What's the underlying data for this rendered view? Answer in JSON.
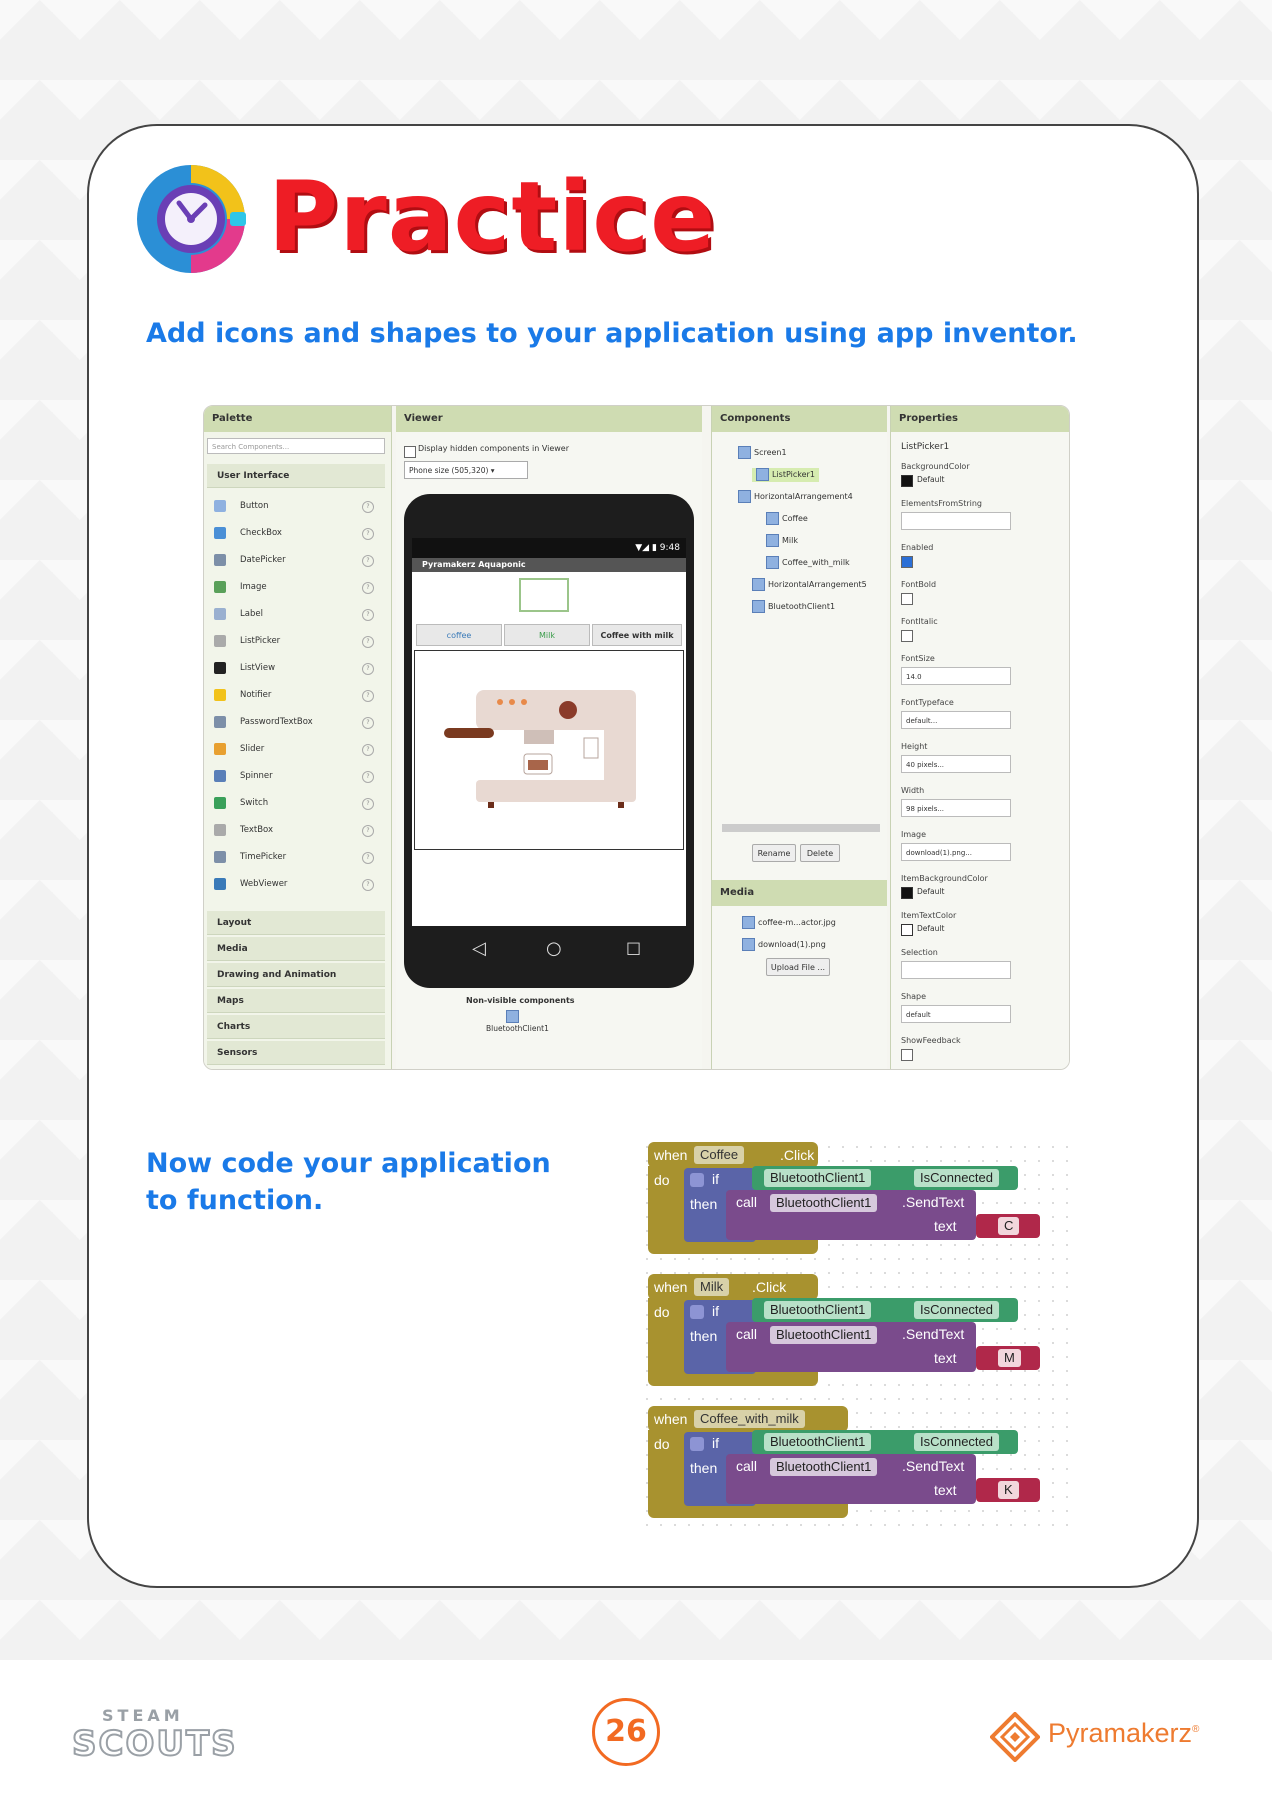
{
  "page": {
    "title": "Practice",
    "instruction_1": "Add icons and shapes to your application using app inventor.",
    "instruction_2": "Now code your application to function.",
    "page_number": "26"
  },
  "designer": {
    "palette": {
      "header": "Palette",
      "search_placeholder": "Search Components...",
      "section": "User Interface",
      "items": [
        "Button",
        "CheckBox",
        "DatePicker",
        "Image",
        "Label",
        "ListPicker",
        "ListView",
        "Notifier",
        "PasswordTextBox",
        "Slider",
        "Spinner",
        "Switch",
        "TextBox",
        "TimePicker",
        "WebViewer"
      ],
      "categories": [
        "Layout",
        "Media",
        "Drawing and Animation",
        "Maps",
        "Charts",
        "Sensors"
      ]
    },
    "viewer": {
      "header": "Viewer",
      "display_hidden": "Display hidden components in Viewer",
      "phone_size": "Phone size (505,320)",
      "status_time": "9:48",
      "app_title": "Pyramakerz Aquaponic",
      "buttons": [
        "coffee",
        "Milk",
        "Coffee with milk"
      ],
      "nonvisible_label": "Non-visible components",
      "nonvisible_item": "BluetoothClient1"
    },
    "components": {
      "header": "Components",
      "tree": [
        "Screen1",
        "ListPicker1",
        "HorizontalArrangement4",
        "Coffee",
        "Milk",
        "Coffee_with_milk",
        "HorizontalArrangement5",
        "BluetoothClient1"
      ],
      "rename": "Rename",
      "delete": "Delete",
      "media_header": "Media",
      "media_files": [
        "coffee-m...actor.jpg",
        "download(1).png"
      ],
      "upload": "Upload File ..."
    },
    "properties": {
      "header": "Properties",
      "component": "ListPicker1",
      "items": [
        {
          "label": "BackgroundColor",
          "value": "Default"
        },
        {
          "label": "ElementsFromString",
          "value": ""
        },
        {
          "label": "Enabled",
          "value": ""
        },
        {
          "label": "FontBold",
          "value": ""
        },
        {
          "label": "FontItalic",
          "value": ""
        },
        {
          "label": "FontSize",
          "value": "14.0"
        },
        {
          "label": "FontTypeface",
          "value": "default..."
        },
        {
          "label": "Height",
          "value": "40 pixels..."
        },
        {
          "label": "Width",
          "value": "98 pixels..."
        },
        {
          "label": "Image",
          "value": "download(1).png..."
        },
        {
          "label": "ItemBackgroundColor",
          "value": "Default"
        },
        {
          "label": "ItemTextColor",
          "value": "Default"
        },
        {
          "label": "Selection",
          "value": ""
        },
        {
          "label": "Shape",
          "value": "default"
        },
        {
          "label": "ShowFeedback",
          "value": ""
        }
      ]
    }
  },
  "blocks": {
    "events": [
      {
        "component": "Coffee",
        "letter": "C"
      },
      {
        "component": "Milk",
        "letter": "M"
      },
      {
        "component": "Coffee_with_milk",
        "letter": "K"
      }
    ],
    "when": "when",
    "click": ".Click",
    "do": "do",
    "if": "if",
    "then": "then",
    "call": "call",
    "bt": "BluetoothClient1",
    "is_connected": "IsConnected",
    "send_text": ".SendText",
    "text": "text"
  },
  "footer": {
    "steam_top": "STEAM",
    "steam_main": "SCOUTS",
    "brand": "Pyramakerz"
  },
  "colors": {
    "title": "#ee1d25",
    "instruction": "#1a7ae8",
    "page_number": "#f26a22",
    "brand": "#ee7b30"
  }
}
